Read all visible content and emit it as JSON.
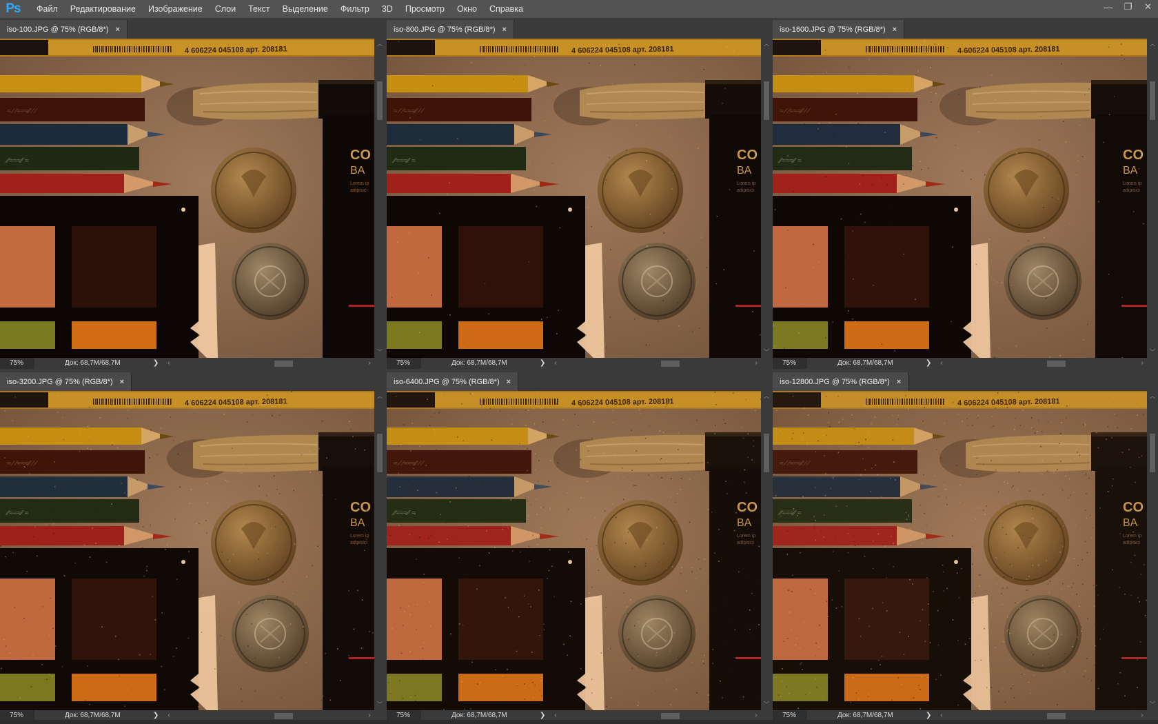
{
  "app": {
    "logo": "Ps",
    "colors": {
      "menubar": "#535353",
      "workspace": "#3b3b3b",
      "tab_active": "#4a4a4a",
      "logo_blue": "#31a8ff"
    }
  },
  "menu": [
    "Файл",
    "Редактирование",
    "Изображение",
    "Слои",
    "Текст",
    "Выделение",
    "Фильтр",
    "3D",
    "Просмотр",
    "Окно",
    "Справка"
  ],
  "window_controls": [
    "minimize-icon",
    "restore-icon",
    "close-icon"
  ],
  "documents": [
    {
      "title": "iso-100.JPG @ 75% (RGB/8*)",
      "zoom": "75%",
      "doc_size": "Док: 68,7M/68,7M",
      "noise": 0.0
    },
    {
      "title": "iso-800.JPG @ 75% (RGB/8*)",
      "zoom": "75%",
      "doc_size": "Док: 68,7M/68,7M",
      "noise": 0.05
    },
    {
      "title": "iso-1600.JPG @ 75% (RGB/8*)",
      "zoom": "75%",
      "doc_size": "Док: 68,7M/68,7M",
      "noise": 0.08
    },
    {
      "title": "iso-3200.JPG @ 75% (RGB/8*)",
      "zoom": "75%",
      "doc_size": "Док: 68,7M/68,7M",
      "noise": 0.12
    },
    {
      "title": "iso-6400.JPG @ 75% (RGB/8*)",
      "zoom": "75%",
      "doc_size": "Док: 68,7M/68,7M",
      "noise": 0.18
    },
    {
      "title": "iso-12800.JPG @ 75% (RGB/8*)",
      "zoom": "75%",
      "doc_size": "Док: 68,7M/68,7M",
      "noise": 0.26
    }
  ],
  "photo_text": {
    "pencil_barcode": "4 606224 045108 арт. 208181",
    "box_title_1": "CO",
    "box_title_2": "BA",
    "box_lorem_1": "Lorem ip",
    "box_lorem_2": "adipisici"
  },
  "icons": {
    "tab_close": "×",
    "scroll_up": "︿",
    "scroll_down": "﹀",
    "scroll_left": "‹",
    "scroll_right": "›",
    "status_menu": "❯"
  }
}
